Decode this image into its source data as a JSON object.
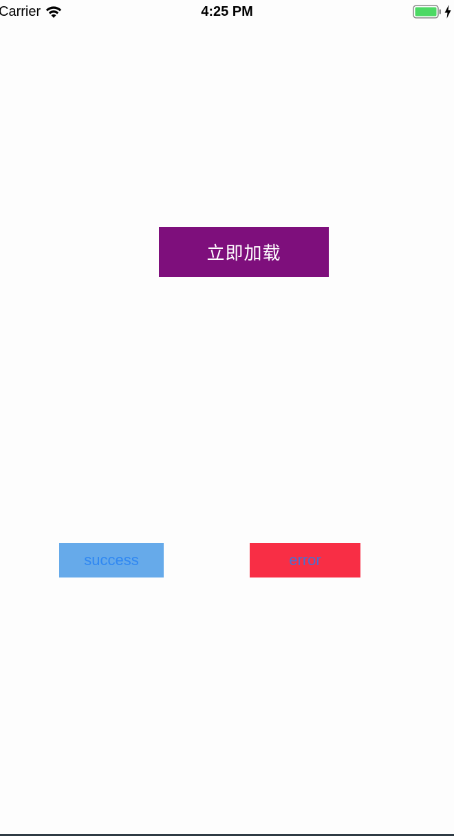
{
  "status_bar": {
    "carrier": "Carrier",
    "time": "4:25 PM",
    "icons": [
      "wifi-icon",
      "battery-icon",
      "charging-bolt-icon"
    ],
    "battery_color": "#4cd964"
  },
  "main": {
    "load_button_label": "立即加载",
    "success_button_label": "success",
    "error_button_label": "error"
  },
  "colors": {
    "load_button_bg": "#7e0f7c",
    "success_button_bg": "#66aaea",
    "success_text": "#2f87f2",
    "error_button_bg": "#f82e45",
    "error_text": "#4a6fd0"
  }
}
